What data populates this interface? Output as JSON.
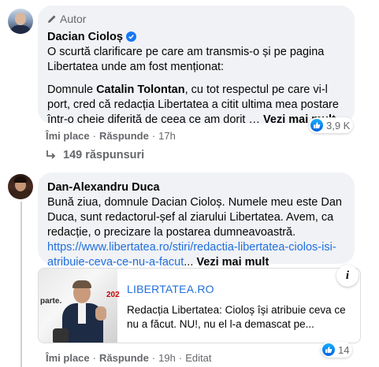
{
  "comment1": {
    "author_badge": "Autor",
    "author": "Dacian Cioloș",
    "para1": "O scurtă clarificare pe care am transmis-o și pe pagina Libertatea unde am fost menționat:",
    "para2_prefix": "Domnule ",
    "para2_mention": "Catalin Tolontan",
    "para2_rest": ", cu tot respectul pe care vi-l port, cred că redacția Libertatea a citit ultima mea postare într-o cheie diferită de ceea ce am dorit … ",
    "see_more": "Vezi mai mult",
    "reaction_count": "3,9 K",
    "actions": {
      "like": "Îmi place",
      "reply": "Răspunde",
      "time": "17h"
    },
    "replies_label": "149 răspunsuri"
  },
  "comment2": {
    "author": "Dan-Alexandru Duca",
    "text": "Bună ziua, domnule Dacian Cioloș. Numele meu este Dan Duca, sunt redactorul-șef al ziarului Libertatea. Avem, ca redacție, o precizare la postarea dumneavoastră.",
    "link": "https://www.libertatea.ro/stiri/redactia-libertatea-ciolos-isi-atribuie-ceva-ce-nu-a-facut",
    "ellipsis": "... ",
    "see_more": "Vezi mai mult",
    "card": {
      "site": "LIBERTATEA.RO",
      "title": "Redacția Libertatea: Cioloș își atribuie ceva ce nu a făcut. NU!, nu el l-a demascat pe...",
      "image_text_left": "parte.",
      "image_text_right": "202"
    },
    "info_label": "i",
    "reaction_count": "14",
    "actions": {
      "like": "Îmi place",
      "reply": "Răspunde",
      "time": "19h",
      "edited": "Editat"
    }
  },
  "colors": {
    "bubble": "#f0f2f5",
    "link": "#216fdb",
    "muted": "#65676b",
    "like": "#1877f2"
  }
}
